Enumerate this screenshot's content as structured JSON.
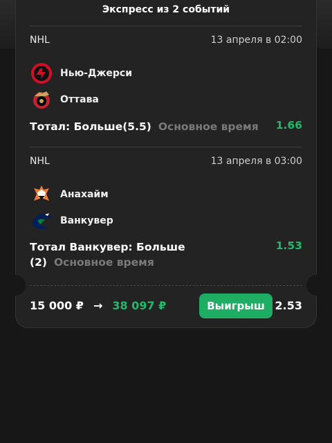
{
  "header": {
    "title": "Экспресс из 2 событий"
  },
  "events": [
    {
      "league": "NHL",
      "datetime": "13 апреля в 02:00",
      "teams": [
        {
          "name": "Нью-Джерси",
          "icon": "devils-logo-icon",
          "color": "#ce1126"
        },
        {
          "name": "Оттава",
          "icon": "senators-logo-icon",
          "color": "#c52032"
        }
      ],
      "market": "Тотал: Больше(5.5)",
      "period": "Основное время",
      "odds": "1.66"
    },
    {
      "league": "NHL",
      "datetime": "13 апреля в 03:00",
      "teams": [
        {
          "name": "Анахайм",
          "icon": "ducks-logo-icon",
          "color": "#f47a38"
        },
        {
          "name": "Ванкувер",
          "icon": "canucks-logo-icon",
          "color": "#00205b"
        }
      ],
      "market": "Тотал Ванкувер: Больше (2)",
      "period": "Основное время",
      "odds": "1.53"
    }
  ],
  "footer": {
    "stake": "15 000 ₽",
    "arrow": "→",
    "payout": "38 097 ₽",
    "status_button": "Выигрыш",
    "total_odds": "2.53"
  },
  "colors": {
    "accent": "#1dae63",
    "odds_green": "#21b96a",
    "muted": "#7a7a7a",
    "card": "#232323"
  }
}
